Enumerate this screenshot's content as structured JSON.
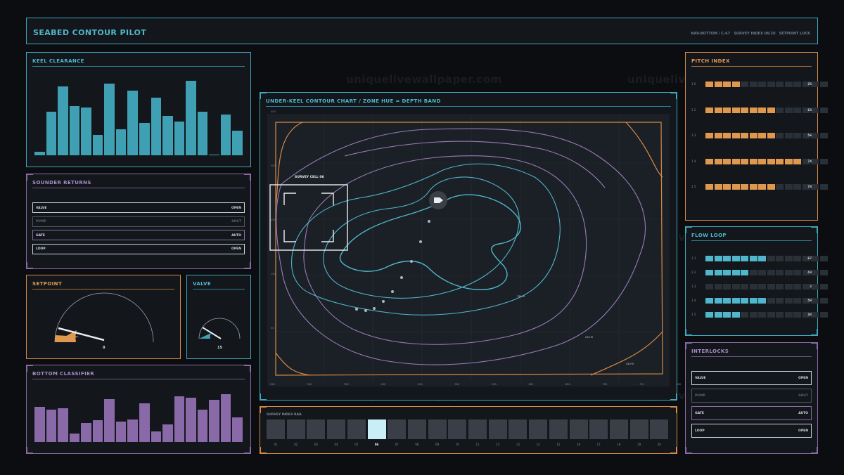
{
  "header": {
    "title": "SEABED CONTOUR PILOT",
    "meta_left": "NAV-BOTTOM / C-67",
    "meta_mid": "SURVEY INDEX 06/20",
    "meta_right": "SETPOINT LOCK"
  },
  "watermark": "uniquelivewallpaper.com",
  "keel": {
    "title": "KEEL CLEARANCE",
    "values": [
      4,
      52,
      82,
      58,
      57,
      24,
      85,
      31,
      77,
      38,
      68,
      47,
      40,
      88,
      52,
      0,
      48,
      29
    ],
    "color": "#3f9fb3"
  },
  "sounder": {
    "title": "SOUNDER RETURNS",
    "rows": [
      {
        "label": "VALVE",
        "state": "OPEN",
        "style": "bright"
      },
      {
        "label": "PUMP",
        "state": "SHUT",
        "style": "dim"
      },
      {
        "label": "GATE",
        "state": "AUTO",
        "style": "purple"
      },
      {
        "label": "LOOP",
        "state": "OPEN",
        "style": "bright"
      }
    ]
  },
  "setpoint": {
    "title": "SETPOINT",
    "value": "8",
    "level": 0.08
  },
  "valve": {
    "title": "VALVE",
    "value": "15",
    "level": 0.15
  },
  "bottom": {
    "title": "BOTTOM CLASSIFIER",
    "values": [
      60,
      55,
      58,
      15,
      33,
      37,
      74,
      35,
      38,
      66,
      18,
      30,
      78,
      76,
      55,
      72,
      82,
      42
    ],
    "color": "#8a69a8"
  },
  "chart": {
    "title": "UNDER-KEEL CONTOUR CHART / ZONE HUE = DEPTH BAND",
    "survey_cell": "SURVEY CELL 06",
    "y_ticks": [
      "450",
      "300",
      "250",
      "150",
      "50"
    ],
    "x_ticks": [
      "250",
      "300",
      "350",
      "400",
      "450",
      "500",
      "550",
      "600",
      "650",
      "700",
      "750",
      "800"
    ],
    "contour_labels": [
      "330 M",
      "210 M",
      "420 M"
    ]
  },
  "rail": {
    "title": "SURVEY INDEX RAIL",
    "labels": [
      "01",
      "02",
      "03",
      "04",
      "05",
      "06",
      "07",
      "08",
      "09",
      "10",
      "11",
      "12",
      "13",
      "14",
      "15",
      "16",
      "17",
      "18",
      "19",
      "20"
    ],
    "active_index": 5
  },
  "pitch": {
    "title": "PITCH INDEX",
    "rows": [
      {
        "label": "1.0",
        "filled": 4,
        "value": "25"
      },
      {
        "label": "1.2",
        "filled": 8,
        "value": "63"
      },
      {
        "label": "1.3",
        "filled": 8,
        "value": "56"
      },
      {
        "label": "1.4",
        "filled": 11,
        "value": "74"
      },
      {
        "label": "1.5",
        "filled": 8,
        "value": "78"
      }
    ],
    "total": 14,
    "color": "#e0984f"
  },
  "flow": {
    "title": "FLOW LOOP",
    "rows": [
      {
        "label": "1.1",
        "filled": 7,
        "value": "67"
      },
      {
        "label": "1.2",
        "filled": 5,
        "value": "43"
      },
      {
        "label": "1.3",
        "filled": 0,
        "value": "2"
      },
      {
        "label": "1.4",
        "filled": 7,
        "value": "59"
      },
      {
        "label": "1.5",
        "filled": 4,
        "value": "34"
      }
    ],
    "total": 14,
    "color": "#4fb6cc"
  },
  "interlocks": {
    "title": "INTERLOCKS",
    "rows": [
      {
        "label": "VALVE",
        "state": "OPEN",
        "style": "bright"
      },
      {
        "label": "PUMP",
        "state": "SHUT",
        "style": "dim"
      },
      {
        "label": "GATE",
        "state": "AUTO",
        "style": "purple"
      },
      {
        "label": "LOOP",
        "state": "OPEN",
        "style": "bright"
      }
    ]
  }
}
